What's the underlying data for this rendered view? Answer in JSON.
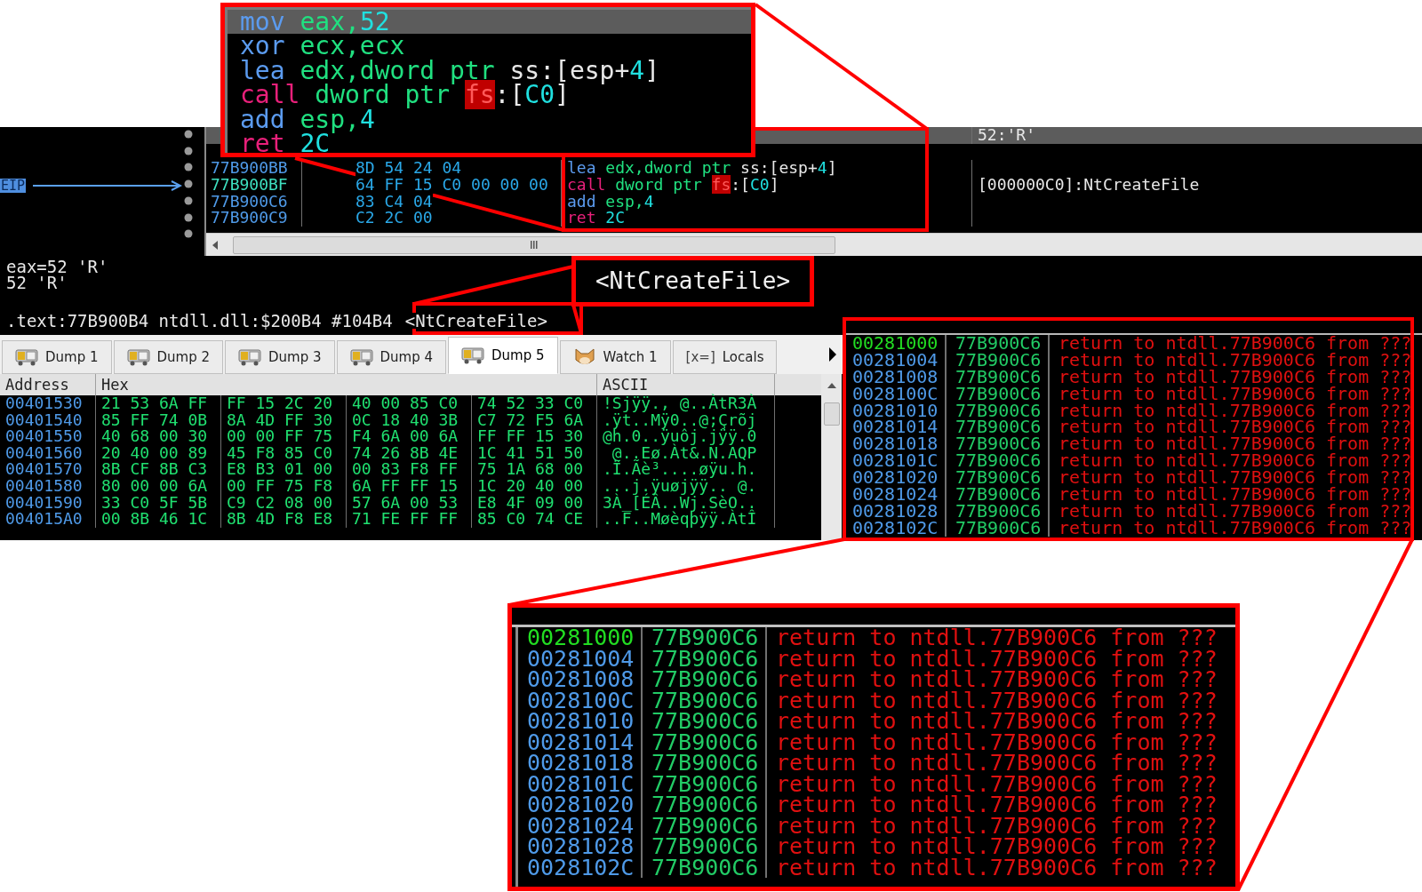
{
  "zoom_top": {
    "lines": [
      {
        "selected": true,
        "parts": [
          {
            "text": "mov",
            "kind": "op"
          },
          {
            "text": " eax,",
            "kind": "reg"
          },
          {
            "text": "52",
            "kind": "num"
          }
        ]
      },
      {
        "selected": false,
        "parts": [
          {
            "text": "xor",
            "kind": "op"
          },
          {
            "text": " ecx,ecx",
            "kind": "reg"
          }
        ]
      },
      {
        "selected": false,
        "parts": [
          {
            "text": "lea",
            "kind": "op"
          },
          {
            "text": " edx,dword ptr",
            "kind": "reg"
          },
          {
            "text": " ss:[esp+",
            "kind": "mem"
          },
          {
            "text": "4",
            "kind": "num"
          },
          {
            "text": "]",
            "kind": "mem"
          }
        ]
      },
      {
        "selected": false,
        "parts": [
          {
            "text": "call",
            "kind": "call"
          },
          {
            "text": " dword ptr ",
            "kind": "reg"
          },
          {
            "text": "fs",
            "kind": "fs"
          },
          {
            "text": ":[",
            "kind": "mem"
          },
          {
            "text": "C0",
            "kind": "num"
          },
          {
            "text": "]",
            "kind": "mem"
          }
        ]
      },
      {
        "selected": false,
        "parts": [
          {
            "text": "add",
            "kind": "op"
          },
          {
            "text": " esp,",
            "kind": "reg"
          },
          {
            "text": "4",
            "kind": "num"
          }
        ]
      },
      {
        "selected": false,
        "parts": [
          {
            "text": "ret",
            "kind": "call"
          },
          {
            "text": " 2C",
            "kind": "num"
          }
        ]
      }
    ]
  },
  "disassembly": {
    "eip_label": "EIP",
    "rows": [
      {
        "selected": true,
        "comment": "52:'R'"
      },
      {
        "selected": false,
        "eip": false,
        "address": "77B900BB",
        "bytes": "8D 54 24 04",
        "parts": [
          {
            "text": "lea",
            "kind": "op"
          },
          {
            "text": " edx,dword ptr",
            "kind": "reg"
          },
          {
            "text": " ss:[esp+",
            "kind": "mem"
          },
          {
            "text": "4",
            "kind": "num"
          },
          {
            "text": "]",
            "kind": "mem"
          }
        ]
      },
      {
        "selected": false,
        "eip": true,
        "address": "77B900BF",
        "bytes": "64 FF 15 C0 00 00 00",
        "parts": [
          {
            "text": "call",
            "kind": "call"
          },
          {
            "text": " dword ptr ",
            "kind": "reg"
          },
          {
            "text": "fs",
            "kind": "fs"
          },
          {
            "text": ":[",
            "kind": "mem"
          },
          {
            "text": "C0",
            "kind": "num"
          },
          {
            "text": "]",
            "kind": "mem"
          }
        ],
        "comment": "[000000C0]:NtCreateFile"
      },
      {
        "selected": false,
        "eip": false,
        "address": "77B900C6",
        "bytes": "83 C4 04",
        "parts": [
          {
            "text": "add",
            "kind": "op"
          },
          {
            "text": " esp,",
            "kind": "reg"
          },
          {
            "text": "4",
            "kind": "num"
          }
        ]
      },
      {
        "selected": false,
        "eip": false,
        "address": "77B900C9",
        "bytes": "C2 2C 00",
        "parts": [
          {
            "text": "ret",
            "kind": "call"
          },
          {
            "text": " 2C",
            "kind": "num"
          }
        ]
      }
    ]
  },
  "info": {
    "lines": [
      "eax=52 'R'",
      "52 'R'"
    ],
    "location": ".text:77B900B4 ntdll.dll:$200B4 #104B4",
    "symbol": "<NtCreateFile>"
  },
  "zoom_symbol": {
    "text": "<NtCreateFile>"
  },
  "tabs": [
    {
      "label": "Dump 1",
      "kind": "dump",
      "selected": false
    },
    {
      "label": "Dump 2",
      "kind": "dump",
      "selected": false
    },
    {
      "label": "Dump 3",
      "kind": "dump",
      "selected": false
    },
    {
      "label": "Dump 4",
      "kind": "dump",
      "selected": false
    },
    {
      "label": "Dump 5",
      "kind": "dump",
      "selected": true
    },
    {
      "label": "Watch 1",
      "kind": "watch",
      "selected": false
    },
    {
      "label": "Locals",
      "kind": "locals",
      "icon_text": "[x=]",
      "selected": false
    }
  ],
  "dump": {
    "columns": [
      "Address",
      "Hex",
      "ASCII"
    ],
    "rows": [
      {
        "address": "00401530",
        "hex": [
          "21 53 6A FF",
          "FF 15 2C 20",
          "40 00 85 C0",
          "74 52 33 C0"
        ],
        "ascii": "!Sjÿÿ., @..ÀtR3À"
      },
      {
        "address": "00401540",
        "hex": [
          "85 FF 74 0B",
          "8A 4D FF 30",
          "0C 18 40 3B",
          "C7 72 F5 6A"
        ],
        "ascii": ".ÿt..Mÿ0..@;Çrõj"
      },
      {
        "address": "00401550",
        "hex": [
          "40 68 00 30",
          "00 00 FF 75",
          "F4 6A 00 6A",
          "FF FF 15 30"
        ],
        "ascii": "@h.0..ÿuôj.jÿÿ.0"
      },
      {
        "address": "00401560",
        "hex": [
          "20 40 00 89",
          "45 F8 85 C0",
          "74 26 8B 4E",
          "1C 41 51 50"
        ],
        "ascii": " @..Eø.Àt&.N.AQP"
      },
      {
        "address": "00401570",
        "hex": [
          "8B CF 8B C3",
          "E8 B3 01 00",
          "00 83 F8 FF",
          "75 1A 68 00"
        ],
        "ascii": ".Ï.Ãè³....øÿu.h."
      },
      {
        "address": "00401580",
        "hex": [
          "80 00 00 6A",
          "00 FF 75 F8",
          "6A FF FF 15",
          "1C 20 40 00"
        ],
        "ascii": "...j.ÿuøjÿÿ.. @."
      },
      {
        "address": "00401590",
        "hex": [
          "33 C0 5F 5B",
          "C9 C2 08 00",
          "57 6A 00 53",
          "E8 4F 09 00"
        ],
        "ascii": "3À_[ÉÂ..Wj.SèO.."
      },
      {
        "address": "004015A0",
        "hex": [
          "00 8B 46 1C",
          "8B 4D F8 E8",
          "71 FE FF FF",
          "85 C0 74 CE"
        ],
        "ascii": "..F..Møèqþÿÿ.ÀtÎ"
      }
    ]
  },
  "stack": {
    "rows": [
      {
        "address": "00281000",
        "value": "77B900C6",
        "comment": "return to ntdll.77B900C6 from ???",
        "current": true
      },
      {
        "address": "00281004",
        "value": "77B900C6",
        "comment": "return to ntdll.77B900C6 from ???",
        "current": false
      },
      {
        "address": "00281008",
        "value": "77B900C6",
        "comment": "return to ntdll.77B900C6 from ???",
        "current": false
      },
      {
        "address": "0028100C",
        "value": "77B900C6",
        "comment": "return to ntdll.77B900C6 from ???",
        "current": false
      },
      {
        "address": "00281010",
        "value": "77B900C6",
        "comment": "return to ntdll.77B900C6 from ???",
        "current": false
      },
      {
        "address": "00281014",
        "value": "77B900C6",
        "comment": "return to ntdll.77B900C6 from ???",
        "current": false
      },
      {
        "address": "00281018",
        "value": "77B900C6",
        "comment": "return to ntdll.77B900C6 from ???",
        "current": false
      },
      {
        "address": "0028101C",
        "value": "77B900C6",
        "comment": "return to ntdll.77B900C6 from ???",
        "current": false
      },
      {
        "address": "00281020",
        "value": "77B900C6",
        "comment": "return to ntdll.77B900C6 from ???",
        "current": false
      },
      {
        "address": "00281024",
        "value": "77B900C6",
        "comment": "return to ntdll.77B900C6 from ???",
        "current": false
      },
      {
        "address": "00281028",
        "value": "77B900C6",
        "comment": "return to ntdll.77B900C6 from ???",
        "current": false
      },
      {
        "address": "0028102C",
        "value": "77B900C6",
        "comment": "return to ntdll.77B900C6 from ???",
        "current": false
      }
    ]
  },
  "zoom_stack": {
    "rows": [
      {
        "address": "00281000",
        "value": "77B900C6",
        "comment": "return to ntdll.77B900C6 from ???",
        "current": true
      },
      {
        "address": "00281004",
        "value": "77B900C6",
        "comment": "return to ntdll.77B900C6 from ???",
        "current": false
      },
      {
        "address": "00281008",
        "value": "77B900C6",
        "comment": "return to ntdll.77B900C6 from ???",
        "current": false
      },
      {
        "address": "0028100C",
        "value": "77B900C6",
        "comment": "return to ntdll.77B900C6 from ???",
        "current": false
      },
      {
        "address": "00281010",
        "value": "77B900C6",
        "comment": "return to ntdll.77B900C6 from ???",
        "current": false
      },
      {
        "address": "00281014",
        "value": "77B900C6",
        "comment": "return to ntdll.77B900C6 from ???",
        "current": false
      },
      {
        "address": "00281018",
        "value": "77B900C6",
        "comment": "return to ntdll.77B900C6 from ???",
        "current": false
      },
      {
        "address": "0028101C",
        "value": "77B900C6",
        "comment": "return to ntdll.77B900C6 from ???",
        "current": false
      },
      {
        "address": "00281020",
        "value": "77B900C6",
        "comment": "return to ntdll.77B900C6 from ???",
        "current": false
      },
      {
        "address": "00281024",
        "value": "77B900C6",
        "comment": "return to ntdll.77B900C6 from ???",
        "current": false
      },
      {
        "address": "00281028",
        "value": "77B900C6",
        "comment": "return to ntdll.77B900C6 from ???",
        "current": false
      },
      {
        "address": "0028102C",
        "value": "77B900C6",
        "comment": "return to ntdll.77B900C6 from ???",
        "current": false
      }
    ]
  }
}
